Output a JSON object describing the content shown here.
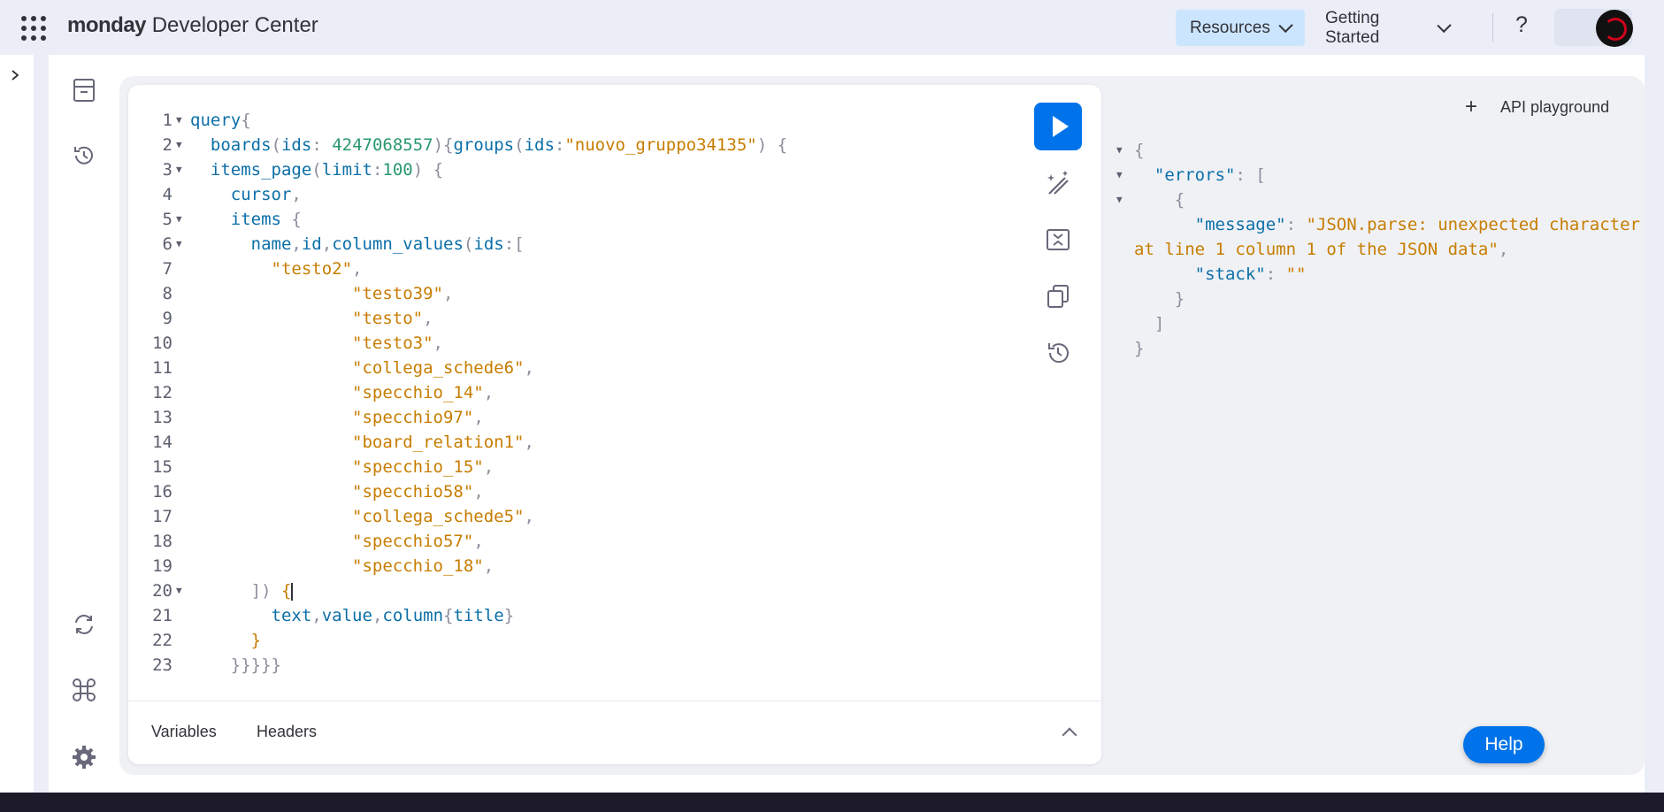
{
  "app": {
    "brand_bold": "monday",
    "brand_rest": "Developer Center"
  },
  "nav": {
    "resources": "Resources",
    "getting_started": "Getting Started",
    "help": "?"
  },
  "editor": {
    "lines": [
      {
        "n": "1",
        "fold": true
      },
      {
        "n": "2",
        "fold": true
      },
      {
        "n": "3",
        "fold": true
      },
      {
        "n": "4",
        "fold": false
      },
      {
        "n": "5",
        "fold": true
      },
      {
        "n": "6",
        "fold": true
      },
      {
        "n": "7",
        "fold": false
      },
      {
        "n": "8",
        "fold": false
      },
      {
        "n": "9",
        "fold": false
      },
      {
        "n": "10",
        "fold": false
      },
      {
        "n": "11",
        "fold": false
      },
      {
        "n": "12",
        "fold": false
      },
      {
        "n": "13",
        "fold": false
      },
      {
        "n": "14",
        "fold": false
      },
      {
        "n": "15",
        "fold": false
      },
      {
        "n": "16",
        "fold": false
      },
      {
        "n": "17",
        "fold": false
      },
      {
        "n": "18",
        "fold": false
      },
      {
        "n": "19",
        "fold": false
      },
      {
        "n": "20",
        "fold": true
      },
      {
        "n": "21",
        "fold": false
      },
      {
        "n": "22",
        "fold": false
      },
      {
        "n": "23",
        "fold": false
      }
    ],
    "code": {
      "l1_kw": "query",
      "l1_p": "{",
      "l2_fn": "boards",
      "l2_p1": "(",
      "l2_arg": "ids",
      "l2_p2": ": ",
      "l2_num": "4247068557",
      "l2_p3": "){",
      "l2_fn2": "groups",
      "l2_p4": "(",
      "l2_arg2": "ids",
      "l2_p5": ":",
      "l2_str": "\"nuovo_gruppo34135\"",
      "l2_p6": ") {",
      "l3_fn": "items_page",
      "l3_p1": "(",
      "l3_arg": "limit",
      "l3_p2": ":",
      "l3_num": "100",
      "l3_p3": ") {",
      "l4_f": "cursor",
      "l4_p": ",",
      "l5_f": "items",
      "l5_p": " {",
      "l6_f1": "name",
      "l6_c1": ",",
      "l6_f2": "id",
      "l6_c2": ",",
      "l6_f3": "column_values",
      "l6_p1": "(",
      "l6_arg": "ids",
      "l6_p2": ":[",
      "ids": [
        "\"testo2\"",
        "\"testo39\"",
        "\"testo\"",
        "\"testo3\"",
        "\"collega_schede6\"",
        "\"specchio_14\"",
        "\"specchio97\"",
        "\"board_relation1\"",
        "\"specchio_15\"",
        "\"specchio58\"",
        "\"collega_schede5\"",
        "\"specchio57\"",
        "\"specchio_18\""
      ],
      "comma": ",",
      "l20_p": "]) ",
      "l20_b": "{",
      "l21_f1": "text",
      "l21_c1": ",",
      "l21_f2": "value",
      "l21_c2": ",",
      "l21_f3": "column",
      "l21_p1": "{",
      "l21_f4": "title",
      "l21_p2": "}",
      "l22_b": "}",
      "l23_p": "}}}}}"
    },
    "footer": {
      "variables": "Variables",
      "headers": "Headers"
    }
  },
  "result": {
    "open": "{",
    "errors_key": "\"errors\"",
    "colon": ": ",
    "arr_open": "[",
    "obj_open": "{",
    "message_key": "\"message\"",
    "message_val1": "\"JSON.parse: unexpected character",
    "message_val2": "at line 1 column 1 of the JSON data\"",
    "comma": ",",
    "stack_key": "\"stack\"",
    "stack_val": "\"\"",
    "obj_close": "}",
    "arr_close": "]",
    "close": "}"
  },
  "playground": {
    "title": "API playground",
    "plus": "+"
  },
  "help_button": "Help",
  "colors": {
    "accent": "#0073ea",
    "keyword": "#0b6fa8",
    "string": "#c77d00",
    "number": "#29986d",
    "punct": "#8c8f9c"
  },
  "icons": [
    "apps-grid-icon",
    "chevron-down-icon",
    "question-icon",
    "avatar",
    "sidebar-toggle-icon",
    "archive-icon",
    "history-icon",
    "refresh-icon",
    "command-icon",
    "settings-icon",
    "play-icon",
    "magic-wand-icon",
    "collapse-icon",
    "copy-icon",
    "history-icon",
    "chevron-up-icon",
    "plus-icon"
  ]
}
